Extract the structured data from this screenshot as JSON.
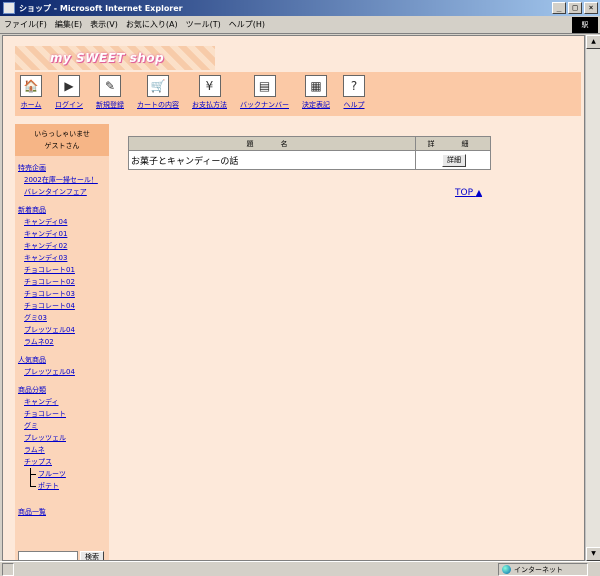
{
  "window": {
    "title": "ショップ - Microsoft Internet Explorer",
    "controls": [
      "_",
      "□",
      "×"
    ]
  },
  "menubar": {
    "items": [
      "ファイル(F)",
      "編集(E)",
      "表示(V)",
      "お気に入り(A)",
      "ツール(T)",
      "ヘルプ(H)"
    ],
    "throbber_label": "駅"
  },
  "logo": {
    "text": "my SWEET shop"
  },
  "nav": {
    "items": [
      {
        "label": "ホーム",
        "icon": "🏠"
      },
      {
        "label": "ログイン",
        "icon": "▶"
      },
      {
        "label": "新規登録",
        "icon": "✎"
      },
      {
        "label": "カートの内容",
        "icon": "🛒"
      },
      {
        "label": "お支払方法",
        "icon": "¥"
      },
      {
        "label": "バックナンバー",
        "icon": "▤"
      },
      {
        "label": "決定表記",
        "icon": "▦"
      },
      {
        "label": "ヘルプ",
        "icon": "?"
      }
    ]
  },
  "sidebar": {
    "welcome_line1": "いらっしゃいませ",
    "welcome_line2": "ゲストさん",
    "special": {
      "head": "特売企画",
      "links": [
        "2002在庫一掃セール！",
        "バレンタインフェア"
      ]
    },
    "new_items": {
      "head": "新着商品",
      "links": [
        "キャンディ04",
        "キャンディ01",
        "キャンディ02",
        "キャンディ03",
        "チョコレート01",
        "チョコレート02",
        "チョコレート03",
        "チョコレート04",
        "グミ03",
        "プレッツェル04",
        "ラムネ02"
      ]
    },
    "popular": {
      "head": "人気商品",
      "links": [
        "プレッツェル04"
      ]
    },
    "category": {
      "head": "商品分類",
      "links": [
        "キャンディ",
        "チョコレート",
        "グミ",
        "プレッツェル",
        "ラムネ",
        "チップス"
      ],
      "sub_links": [
        "フルーツ",
        "ポテト"
      ]
    },
    "all_items": "商品一覧",
    "search_button": "検索"
  },
  "table": {
    "headers": [
      "題　名",
      "詳　細"
    ],
    "rows": [
      {
        "title": "お菓子とキャンディーの話",
        "button": "詳細"
      }
    ]
  },
  "top_link": {
    "label": "TOP",
    "arrow": "▲"
  },
  "statusbar": {
    "zone": "インターネット"
  }
}
